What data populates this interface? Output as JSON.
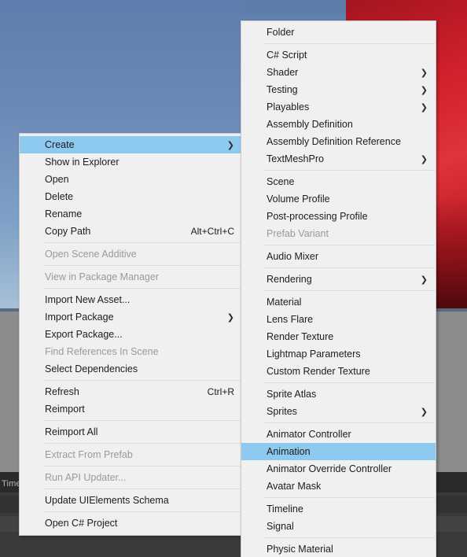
{
  "background": {
    "panel_label": "Time",
    "colors": {
      "sky_top": "#5f7ead",
      "sky_bottom": "#a9c3d8",
      "red": "#d0202b",
      "grey": "#8b8c8d",
      "dark": "#393939",
      "menu_bg": "#f0f0f0",
      "menu_border": "#cacaca",
      "highlight": "#8ec9f0",
      "text": "#1c1c1c",
      "text_disabled": "#9a9a9a"
    }
  },
  "context_menu": {
    "name": "project-context-menu",
    "items": [
      {
        "label": "Create",
        "submenu": true,
        "selected": true,
        "disabled": false,
        "shortcut": ""
      },
      {
        "label": "Show in Explorer",
        "submenu": false,
        "selected": false,
        "disabled": false,
        "shortcut": ""
      },
      {
        "label": "Open",
        "submenu": false,
        "selected": false,
        "disabled": false,
        "shortcut": ""
      },
      {
        "label": "Delete",
        "submenu": false,
        "selected": false,
        "disabled": false,
        "shortcut": ""
      },
      {
        "label": "Rename",
        "submenu": false,
        "selected": false,
        "disabled": false,
        "shortcut": ""
      },
      {
        "label": "Copy Path",
        "submenu": false,
        "selected": false,
        "disabled": false,
        "shortcut": "Alt+Ctrl+C"
      },
      {
        "separator": true
      },
      {
        "label": "Open Scene Additive",
        "submenu": false,
        "selected": false,
        "disabled": true,
        "shortcut": ""
      },
      {
        "separator": true
      },
      {
        "label": "View in Package Manager",
        "submenu": false,
        "selected": false,
        "disabled": true,
        "shortcut": ""
      },
      {
        "separator": true
      },
      {
        "label": "Import New Asset...",
        "submenu": false,
        "selected": false,
        "disabled": false,
        "shortcut": ""
      },
      {
        "label": "Import Package",
        "submenu": true,
        "selected": false,
        "disabled": false,
        "shortcut": ""
      },
      {
        "label": "Export Package...",
        "submenu": false,
        "selected": false,
        "disabled": false,
        "shortcut": ""
      },
      {
        "label": "Find References In Scene",
        "submenu": false,
        "selected": false,
        "disabled": true,
        "shortcut": ""
      },
      {
        "label": "Select Dependencies",
        "submenu": false,
        "selected": false,
        "disabled": false,
        "shortcut": ""
      },
      {
        "separator": true
      },
      {
        "label": "Refresh",
        "submenu": false,
        "selected": false,
        "disabled": false,
        "shortcut": "Ctrl+R"
      },
      {
        "label": "Reimport",
        "submenu": false,
        "selected": false,
        "disabled": false,
        "shortcut": ""
      },
      {
        "separator": true
      },
      {
        "label": "Reimport All",
        "submenu": false,
        "selected": false,
        "disabled": false,
        "shortcut": ""
      },
      {
        "separator": true
      },
      {
        "label": "Extract From Prefab",
        "submenu": false,
        "selected": false,
        "disabled": true,
        "shortcut": ""
      },
      {
        "separator": true
      },
      {
        "label": "Run API Updater...",
        "submenu": false,
        "selected": false,
        "disabled": true,
        "shortcut": ""
      },
      {
        "separator": true
      },
      {
        "label": "Update UIElements Schema",
        "submenu": false,
        "selected": false,
        "disabled": false,
        "shortcut": ""
      },
      {
        "separator": true
      },
      {
        "label": "Open C# Project",
        "submenu": false,
        "selected": false,
        "disabled": false,
        "shortcut": ""
      }
    ]
  },
  "create_submenu": {
    "name": "create-submenu",
    "items": [
      {
        "label": "Folder",
        "submenu": false,
        "selected": false,
        "disabled": false,
        "shortcut": ""
      },
      {
        "separator": true
      },
      {
        "label": "C# Script",
        "submenu": false,
        "selected": false,
        "disabled": false,
        "shortcut": ""
      },
      {
        "label": "Shader",
        "submenu": true,
        "selected": false,
        "disabled": false,
        "shortcut": ""
      },
      {
        "label": "Testing",
        "submenu": true,
        "selected": false,
        "disabled": false,
        "shortcut": ""
      },
      {
        "label": "Playables",
        "submenu": true,
        "selected": false,
        "disabled": false,
        "shortcut": ""
      },
      {
        "label": "Assembly Definition",
        "submenu": false,
        "selected": false,
        "disabled": false,
        "shortcut": ""
      },
      {
        "label": "Assembly Definition Reference",
        "submenu": false,
        "selected": false,
        "disabled": false,
        "shortcut": ""
      },
      {
        "label": "TextMeshPro",
        "submenu": true,
        "selected": false,
        "disabled": false,
        "shortcut": ""
      },
      {
        "separator": true
      },
      {
        "label": "Scene",
        "submenu": false,
        "selected": false,
        "disabled": false,
        "shortcut": ""
      },
      {
        "label": "Volume Profile",
        "submenu": false,
        "selected": false,
        "disabled": false,
        "shortcut": ""
      },
      {
        "label": "Post-processing Profile",
        "submenu": false,
        "selected": false,
        "disabled": false,
        "shortcut": ""
      },
      {
        "label": "Prefab Variant",
        "submenu": false,
        "selected": false,
        "disabled": true,
        "shortcut": ""
      },
      {
        "separator": true
      },
      {
        "label": "Audio Mixer",
        "submenu": false,
        "selected": false,
        "disabled": false,
        "shortcut": ""
      },
      {
        "separator": true
      },
      {
        "label": "Rendering",
        "submenu": true,
        "selected": false,
        "disabled": false,
        "shortcut": ""
      },
      {
        "separator": true
      },
      {
        "label": "Material",
        "submenu": false,
        "selected": false,
        "disabled": false,
        "shortcut": ""
      },
      {
        "label": "Lens Flare",
        "submenu": false,
        "selected": false,
        "disabled": false,
        "shortcut": ""
      },
      {
        "label": "Render Texture",
        "submenu": false,
        "selected": false,
        "disabled": false,
        "shortcut": ""
      },
      {
        "label": "Lightmap Parameters",
        "submenu": false,
        "selected": false,
        "disabled": false,
        "shortcut": ""
      },
      {
        "label": "Custom Render Texture",
        "submenu": false,
        "selected": false,
        "disabled": false,
        "shortcut": ""
      },
      {
        "separator": true
      },
      {
        "label": "Sprite Atlas",
        "submenu": false,
        "selected": false,
        "disabled": false,
        "shortcut": ""
      },
      {
        "label": "Sprites",
        "submenu": true,
        "selected": false,
        "disabled": false,
        "shortcut": ""
      },
      {
        "separator": true
      },
      {
        "label": "Animator Controller",
        "submenu": false,
        "selected": false,
        "disabled": false,
        "shortcut": ""
      },
      {
        "label": "Animation",
        "submenu": false,
        "selected": true,
        "disabled": false,
        "shortcut": ""
      },
      {
        "label": "Animator Override Controller",
        "submenu": false,
        "selected": false,
        "disabled": false,
        "shortcut": ""
      },
      {
        "label": "Avatar Mask",
        "submenu": false,
        "selected": false,
        "disabled": false,
        "shortcut": ""
      },
      {
        "separator": true
      },
      {
        "label": "Timeline",
        "submenu": false,
        "selected": false,
        "disabled": false,
        "shortcut": ""
      },
      {
        "label": "Signal",
        "submenu": false,
        "selected": false,
        "disabled": false,
        "shortcut": ""
      },
      {
        "separator": true
      },
      {
        "label": "Physic Material",
        "submenu": false,
        "selected": false,
        "disabled": false,
        "shortcut": ""
      }
    ]
  }
}
